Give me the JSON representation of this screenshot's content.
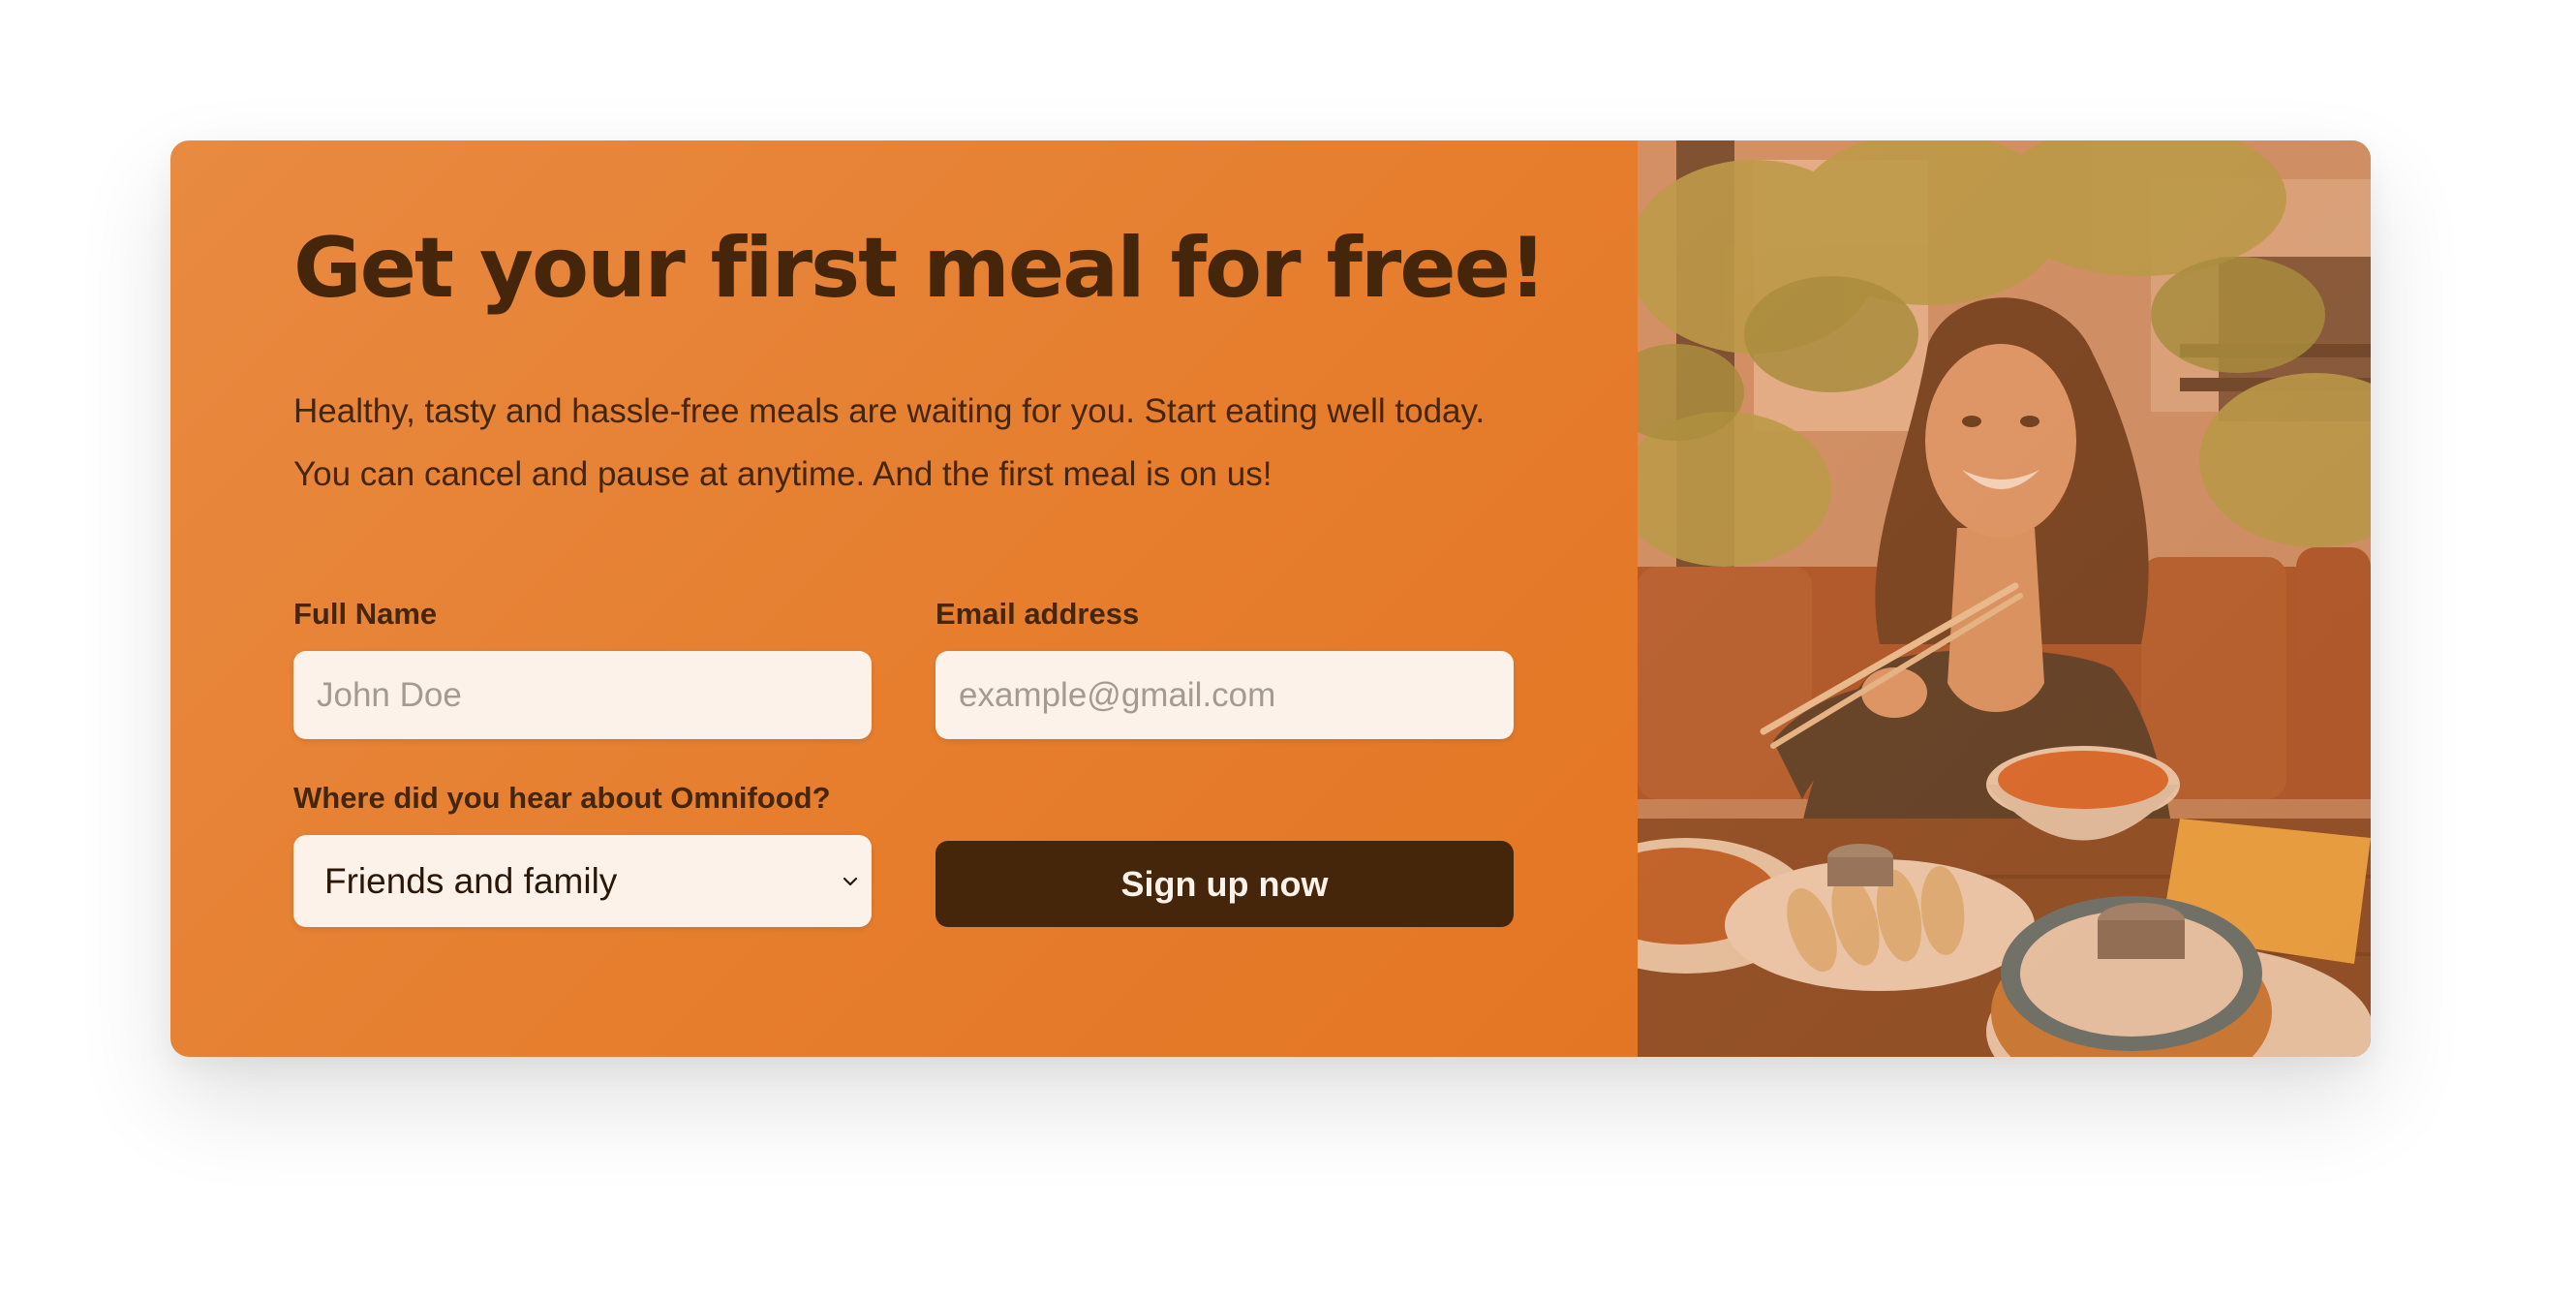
{
  "cta": {
    "heading": "Get your first meal for free!",
    "description": "Healthy, tasty and hassle-free meals are waiting for you. Start eating well today. You can cancel and pause at anytime. And the first meal is on us!",
    "form": {
      "full_name": {
        "label": "Full Name",
        "placeholder": "John Doe",
        "value": ""
      },
      "email": {
        "label": "Email address",
        "placeholder": "example@gmail.com",
        "value": ""
      },
      "source": {
        "label": "Where did you hear about Omnifood?",
        "selected": "Friends and family"
      },
      "submit_label": "Sign up now"
    },
    "image": {
      "subject": "woman eating with chopsticks at restaurant table"
    }
  },
  "icons": {
    "select_chevron": "chevron-down-icon"
  },
  "colors": {
    "panel_bg": "#e67e22",
    "text_dark": "#45260a",
    "input_bg": "#fdf2e9",
    "button_bg": "#45260a",
    "button_text": "#fdf2e9",
    "placeholder": "#a59a92"
  }
}
